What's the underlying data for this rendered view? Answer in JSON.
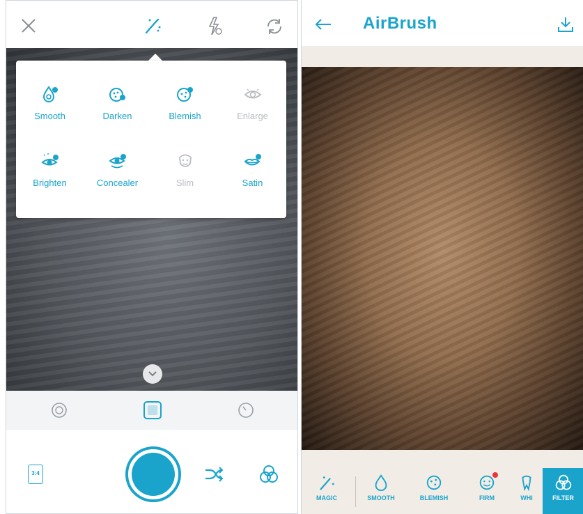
{
  "left_screen": {
    "top_bar": {
      "close_icon": "close-icon",
      "magic_wand_icon": "magic-wand-icon",
      "flash_icon": "flash-icon",
      "switch_camera_icon": "switch-camera-icon"
    },
    "effects_menu": {
      "items": [
        {
          "label": "Smooth",
          "icon": "smooth-icon",
          "enabled": true
        },
        {
          "label": "Darken",
          "icon": "darken-icon",
          "enabled": true
        },
        {
          "label": "Blemish",
          "icon": "blemish-icon",
          "enabled": true
        },
        {
          "label": "Enlarge",
          "icon": "enlarge-icon",
          "enabled": false
        },
        {
          "label": "Brighten",
          "icon": "brighten-icon",
          "enabled": true
        },
        {
          "label": "Concealer",
          "icon": "concealer-icon",
          "enabled": true
        },
        {
          "label": "Slim",
          "icon": "slim-icon",
          "enabled": false
        },
        {
          "label": "Satin",
          "icon": "satin-icon",
          "enabled": true
        }
      ]
    },
    "mode_bar": {
      "modes": [
        "lens-mode-icon",
        "square-mode-icon",
        "timer-mode-icon"
      ],
      "selected": "square-mode-icon"
    },
    "bottom_bar": {
      "ratio_label": "3:4"
    }
  },
  "right_screen": {
    "title": "AirBrush",
    "tools": [
      {
        "label": "MAGIC",
        "icon": "magic-wand-icon"
      },
      {
        "label": "SMOOTH",
        "icon": "smooth-icon"
      },
      {
        "label": "BLEMISH",
        "icon": "blemish-icon"
      },
      {
        "label": "FIRM",
        "icon": "firm-icon",
        "badge": true
      },
      {
        "label": "WHI",
        "icon": "whiten-icon"
      },
      {
        "label": "FILTER",
        "icon": "filter-icon",
        "selected": true
      }
    ]
  },
  "colors": {
    "accent": "#1aa4cc",
    "disabled": "#b9bcc0",
    "badge": "#e8363c"
  }
}
